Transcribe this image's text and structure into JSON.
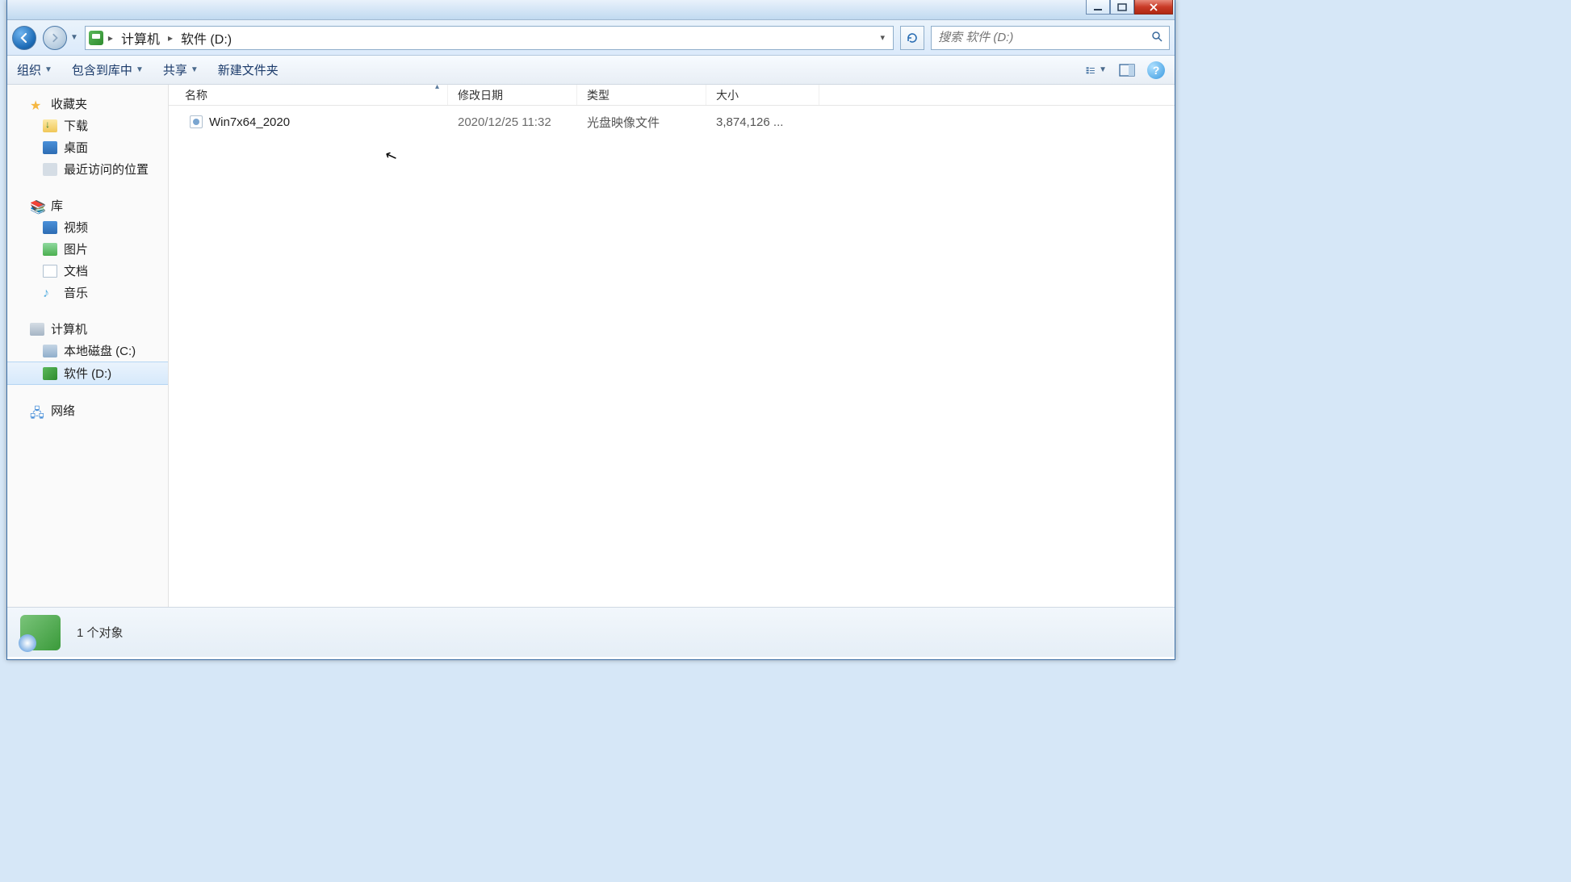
{
  "breadcrumb": {
    "seg1": "计算机",
    "seg2": "软件 (D:)"
  },
  "search": {
    "placeholder": "搜索 软件 (D:)"
  },
  "toolbar": {
    "organize": "组织",
    "include": "包含到库中",
    "share": "共享",
    "newfolder": "新建文件夹"
  },
  "sidebar": {
    "favorites": {
      "label": "收藏夹",
      "items": [
        {
          "label": "下载"
        },
        {
          "label": "桌面"
        },
        {
          "label": "最近访问的位置"
        }
      ]
    },
    "libraries": {
      "label": "库",
      "items": [
        {
          "label": "视频"
        },
        {
          "label": "图片"
        },
        {
          "label": "文档"
        },
        {
          "label": "音乐"
        }
      ]
    },
    "computer": {
      "label": "计算机",
      "items": [
        {
          "label": "本地磁盘 (C:)"
        },
        {
          "label": "软件 (D:)"
        }
      ]
    },
    "network": {
      "label": "网络"
    }
  },
  "columns": {
    "name": "名称",
    "date": "修改日期",
    "type": "类型",
    "size": "大小"
  },
  "files": [
    {
      "name": "Win7x64_2020",
      "date": "2020/12/25 11:32",
      "type": "光盘映像文件",
      "size": "3,874,126 ..."
    }
  ],
  "status": {
    "count": "1 个对象"
  }
}
